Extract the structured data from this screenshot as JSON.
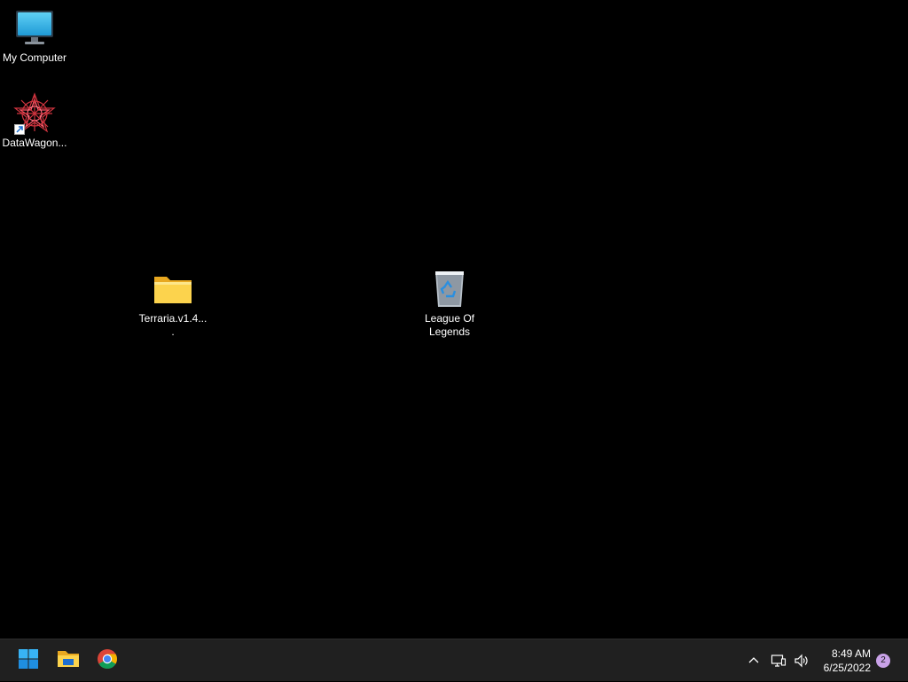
{
  "desktop": {
    "icons": [
      {
        "label": "My Computer",
        "icon": "monitor-icon"
      },
      {
        "label": "DataWagon...",
        "icon": "datawagon-icon",
        "shortcut": true
      },
      {
        "label": "Terraria.v1.4....",
        "icon": "folder-icon"
      },
      {
        "label": "League Of Legends",
        "icon": "recycle-bin-icon"
      }
    ]
  },
  "taskbar": {
    "apps": [
      {
        "name": "Start",
        "icon": "windows-start-icon"
      },
      {
        "name": "File Explorer",
        "icon": "file-explorer-icon"
      },
      {
        "name": "Google Chrome",
        "icon": "chrome-icon"
      }
    ],
    "tray": {
      "icons": [
        "chevron-up-icon",
        "network-icon",
        "volume-icon"
      ],
      "time": "8:49 AM",
      "date": "6/25/2022",
      "notification_count": "2"
    }
  },
  "colors": {
    "desktop_background": "#000000",
    "taskbar_background": "#202020",
    "accent": "#0a84d8",
    "badge": "#c9a2e8"
  }
}
